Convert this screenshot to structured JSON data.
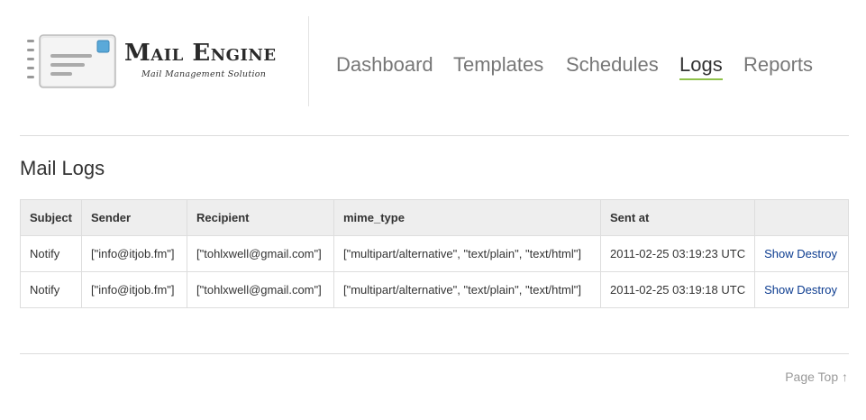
{
  "header": {
    "logo_title": "Mail Engine",
    "logo_subtitle": "Mail Management Solution",
    "nav": [
      {
        "label": "Dashboard",
        "active": false
      },
      {
        "label": "Templates",
        "active": false
      },
      {
        "label": "Schedules",
        "active": false
      },
      {
        "label": "Logs",
        "active": true
      },
      {
        "label": "Reports",
        "active": false
      }
    ]
  },
  "main": {
    "title": "Mail Logs",
    "table": {
      "columns": [
        "Subject",
        "Sender",
        "Recipient",
        "mime_type",
        "Sent at",
        ""
      ],
      "rows": [
        {
          "subject": "Notify",
          "sender": "[\"info@itjob.fm\"]",
          "recipient": "[\"tohlxwell@gmail.com\"]",
          "mime_type": "[\"multipart/alternative\", \"text/plain\", \"text/html\"]",
          "sent_at": "2011-02-25 03:19:23 UTC",
          "show_label": "Show",
          "destroy_label": "Destroy"
        },
        {
          "subject": "Notify",
          "sender": "[\"info@itjob.fm\"]",
          "recipient": "[\"tohlxwell@gmail.com\"]",
          "mime_type": "[\"multipart/alternative\", \"text/plain\", \"text/html\"]",
          "sent_at": "2011-02-25 03:19:18 UTC",
          "show_label": "Show",
          "destroy_label": "Destroy"
        }
      ]
    }
  },
  "footer": {
    "page_top_label": "Page Top ↑"
  },
  "colors": {
    "nav_active_underline": "#8fc14a",
    "link": "#0b3b8f",
    "table_header_bg": "#eeeeee"
  }
}
